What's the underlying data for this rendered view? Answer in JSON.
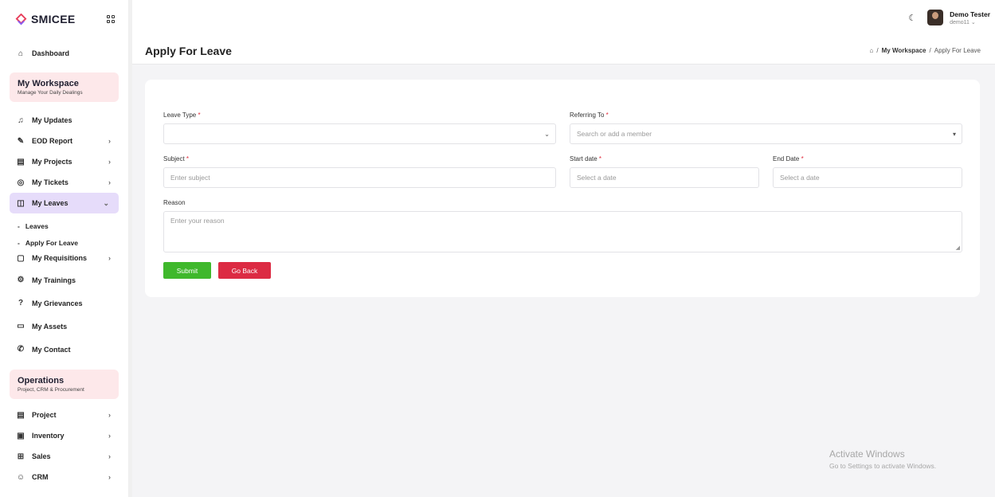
{
  "brand": {
    "name": "SMICEE",
    "accent": "#e83e5b"
  },
  "sidebar": {
    "dashboard": {
      "label": "Dashboard",
      "icon": "home-icon"
    },
    "workspace": {
      "title": "My Workspace",
      "subtitle": "Manage Your Daily Dealings"
    },
    "items": [
      {
        "label": "My Updates",
        "icon": "bell-icon",
        "chevron": false
      },
      {
        "label": "EOD Report",
        "icon": "pen-icon",
        "chevron": true
      },
      {
        "label": "My Projects",
        "icon": "database-icon",
        "chevron": true
      },
      {
        "label": "My Tickets",
        "icon": "target-icon",
        "chevron": true
      },
      {
        "label": "My Leaves",
        "icon": "book-icon",
        "chevron": true,
        "active": true
      }
    ],
    "leave_sub": [
      {
        "label": "Leaves"
      },
      {
        "label": "Apply For Leave"
      }
    ],
    "items2": [
      {
        "label": "My Requisitions",
        "icon": "square-icon",
        "chevron": true
      },
      {
        "label": "My Trainings",
        "icon": "gear-icon",
        "chevron": false
      },
      {
        "label": "My Grievances",
        "icon": "help-icon",
        "chevron": false
      },
      {
        "label": "My Assets",
        "icon": "archive-icon",
        "chevron": false
      },
      {
        "label": "My Contact",
        "icon": "phone-icon",
        "chevron": false
      }
    ],
    "operations": {
      "title": "Operations",
      "subtitle": "Project, CRM & Procurement"
    },
    "items3": [
      {
        "label": "Project",
        "icon": "database-icon",
        "chevron": true
      },
      {
        "label": "Inventory",
        "icon": "box-icon",
        "chevron": true
      },
      {
        "label": "Sales",
        "icon": "bank-icon",
        "chevron": true
      },
      {
        "label": "CRM",
        "icon": "users-icon",
        "chevron": true
      }
    ]
  },
  "user": {
    "name": "Demo Tester",
    "handle": "demo11"
  },
  "page": {
    "title": "Apply For Leave",
    "breadcrumb": [
      "My Workspace",
      "Apply For Leave"
    ]
  },
  "form": {
    "leave_type_label": "Leave Type",
    "referring_label": "Referring To",
    "referring_placeholder": "Search or add a member",
    "subject_label": "Subject",
    "subject_placeholder": "Enter subject",
    "start_label": "Start date",
    "start_placeholder": "Select a date",
    "end_label": "End Date",
    "end_placeholder": "Select a date",
    "reason_label": "Reason",
    "reason_placeholder": "Enter your reason",
    "required_mark": "*",
    "submit_label": "Submit",
    "back_label": "Go Back"
  },
  "watermark": {
    "title": "Activate Windows",
    "subtitle": "Go to Settings to activate Windows."
  }
}
